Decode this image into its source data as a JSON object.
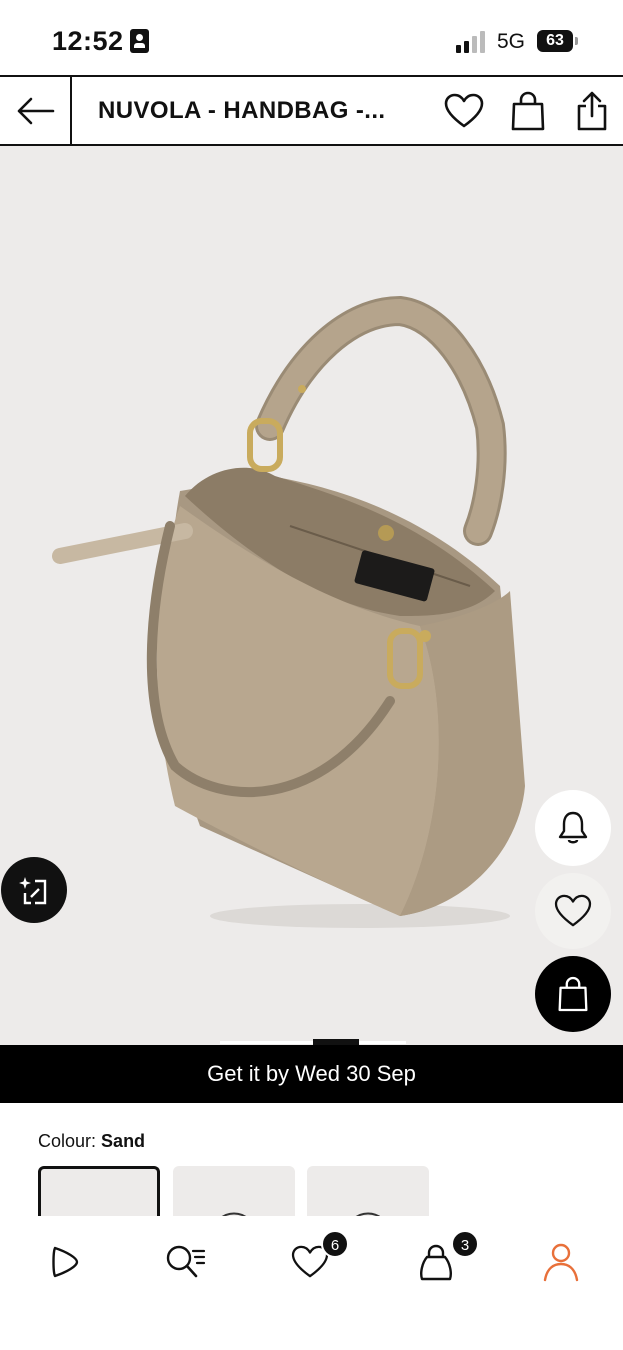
{
  "status_bar": {
    "time": "12:52",
    "network": "5G",
    "battery": "63"
  },
  "header": {
    "title": "NUVOLA - HANDBAG -...",
    "back_icon": "arrow-left-icon",
    "wishlist_icon": "heart-icon",
    "bag_icon": "shopping-bag-icon",
    "share_icon": "share-icon"
  },
  "product_image": {
    "float_buttons": {
      "visual_search_icon": "visual-search-icon",
      "notify_icon": "bell-icon",
      "wishlist_icon": "heart-icon",
      "add_to_bag_icon": "shopping-bag-icon"
    },
    "image_count": 3,
    "current_image": 2
  },
  "delivery": {
    "text": "Get it by Wed 30 Sep"
  },
  "colour": {
    "label": "Colour:",
    "value": "Sand",
    "swatch_count": 3,
    "selected_index": 0
  },
  "bottom_nav": {
    "items": [
      {
        "icon": "play-icon"
      },
      {
        "icon": "search-list-icon"
      },
      {
        "icon": "heart-icon",
        "badge": "6"
      },
      {
        "icon": "shopping-bag-icon",
        "badge": "3"
      },
      {
        "icon": "user-icon"
      }
    ],
    "active_color": "#e8703a"
  },
  "colors": {
    "accent": "#e8703a",
    "bag": "#b5a48c",
    "image_bg": "#edebea"
  }
}
